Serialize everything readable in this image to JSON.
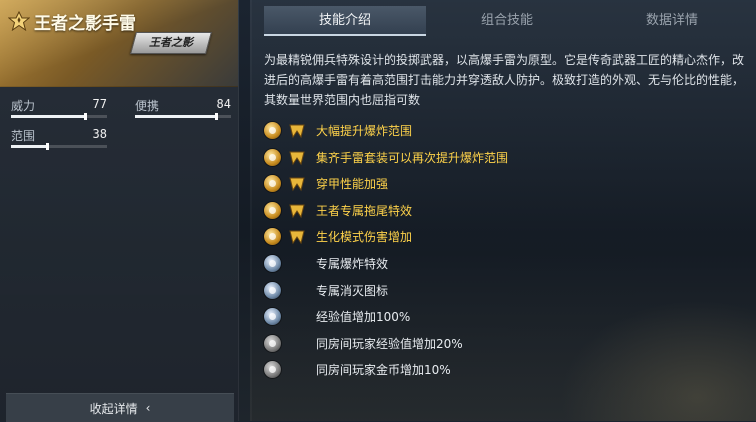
{
  "weapon": {
    "title": "王者之影手雷",
    "badge": "王者之影"
  },
  "stats": [
    {
      "label": "威力",
      "value": "77",
      "fraction": 0.77
    },
    {
      "label": "便携",
      "value": "84",
      "fraction": 0.84
    },
    {
      "label": "范围",
      "value": "38",
      "fraction": 0.38
    }
  ],
  "collapse": {
    "label": "收起详情",
    "icon": "chevron-left-icon"
  },
  "tabs": [
    {
      "label": "技能介绍",
      "active": true
    },
    {
      "label": "组合技能",
      "active": false
    },
    {
      "label": "数据详情",
      "active": false
    }
  ],
  "description": "为最精锐佣兵特殊设计的投掷武器，以高爆手雷为原型。它是传奇武器工匠的精心杰作，改进后的高爆手雷有着高范围打击能力并穿透敌人防护。极致打造的外观、无与伦比的性能，其数量世界范围内也屈指可数",
  "skills": [
    {
      "text": "大幅提升爆炸范围",
      "icon": "explosion-range-icon",
      "style": "gold",
      "tier": true
    },
    {
      "text": "集齐手雷套装可以再次提升爆炸范围",
      "icon": "grenade-set-icon",
      "style": "gold",
      "tier": true
    },
    {
      "text": "穿甲性能加强",
      "icon": "armor-piercing-icon",
      "style": "gold",
      "tier": true
    },
    {
      "text": "王者专属拖尾特效",
      "icon": "trail-effect-icon",
      "style": "gold",
      "tier": true
    },
    {
      "text": "生化模式伤害增加",
      "icon": "zombie-mode-icon",
      "style": "gold",
      "tier": true
    },
    {
      "text": "专属爆炸特效",
      "icon": "explosion-effect-icon",
      "style": "silver",
      "tier": false
    },
    {
      "text": "专属消灭图标",
      "icon": "kill-icon",
      "style": "silver",
      "tier": false
    },
    {
      "text": "经验值增加100%",
      "icon": "exp-icon",
      "style": "silver",
      "tier": false
    },
    {
      "text": "同房间玩家经验值增加20%",
      "icon": "room-exp-icon",
      "style": "grey",
      "tier": false
    },
    {
      "text": "同房间玩家金币增加10%",
      "icon": "room-gold-icon",
      "style": "grey",
      "tier": false
    }
  ],
  "colors": {
    "gold_text": "#ffd34a",
    "header_gold": "#b88a3a",
    "active_tab": "#4a5868"
  }
}
